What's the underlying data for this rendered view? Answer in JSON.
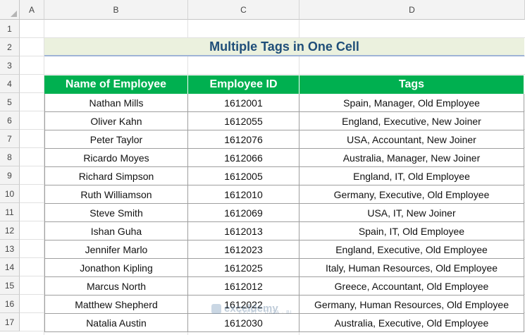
{
  "columns": [
    "A",
    "B",
    "C",
    "D"
  ],
  "rows": [
    "1",
    "2",
    "3",
    "4",
    "5",
    "6",
    "7",
    "8",
    "9",
    "10",
    "11",
    "12",
    "13",
    "14",
    "15",
    "16",
    "17"
  ],
  "title": "Multiple Tags in One Cell",
  "table": {
    "headers": [
      "Name of Employee",
      "Employee ID",
      "Tags"
    ],
    "rows": [
      [
        "Nathan Mills",
        "1612001",
        "Spain, Manager, Old Employee"
      ],
      [
        "Oliver Kahn",
        "1612055",
        "England, Executive, New Joiner"
      ],
      [
        "Peter Taylor",
        "1612076",
        "USA, Accountant, New Joiner"
      ],
      [
        "Ricardo Moyes",
        "1612066",
        "Australia, Manager, New Joiner"
      ],
      [
        "Richard Simpson",
        "1612005",
        "England, IT, Old Employee"
      ],
      [
        "Ruth Williamson",
        "1612010",
        "Germany, Executive, Old Employee"
      ],
      [
        "Steve Smith",
        "1612069",
        "USA, IT, New Joiner"
      ],
      [
        "Ishan Guha",
        "1612013",
        "Spain, IT, Old Employee"
      ],
      [
        "Jennifer Marlo",
        "1612023",
        "England, Executive, Old Employee"
      ],
      [
        "Jonathon Kipling",
        "1612025",
        "Italy, Human Resources, Old Employee"
      ],
      [
        "Marcus North",
        "1612012",
        "Greece, Accountant, Old Employee"
      ],
      [
        "Matthew Shepherd",
        "1612022",
        "Germany, Human Resources, Old Employee"
      ],
      [
        "Natalia Austin",
        "1612030",
        "Australia, Executive, Old Employee"
      ]
    ]
  },
  "watermark": {
    "name": "exceldemy",
    "tagline": "EXCEL · DATA · BI"
  },
  "colors": {
    "header_fill": "#00b050",
    "title_fill": "#ebf1de",
    "title_text": "#1f4e79"
  }
}
